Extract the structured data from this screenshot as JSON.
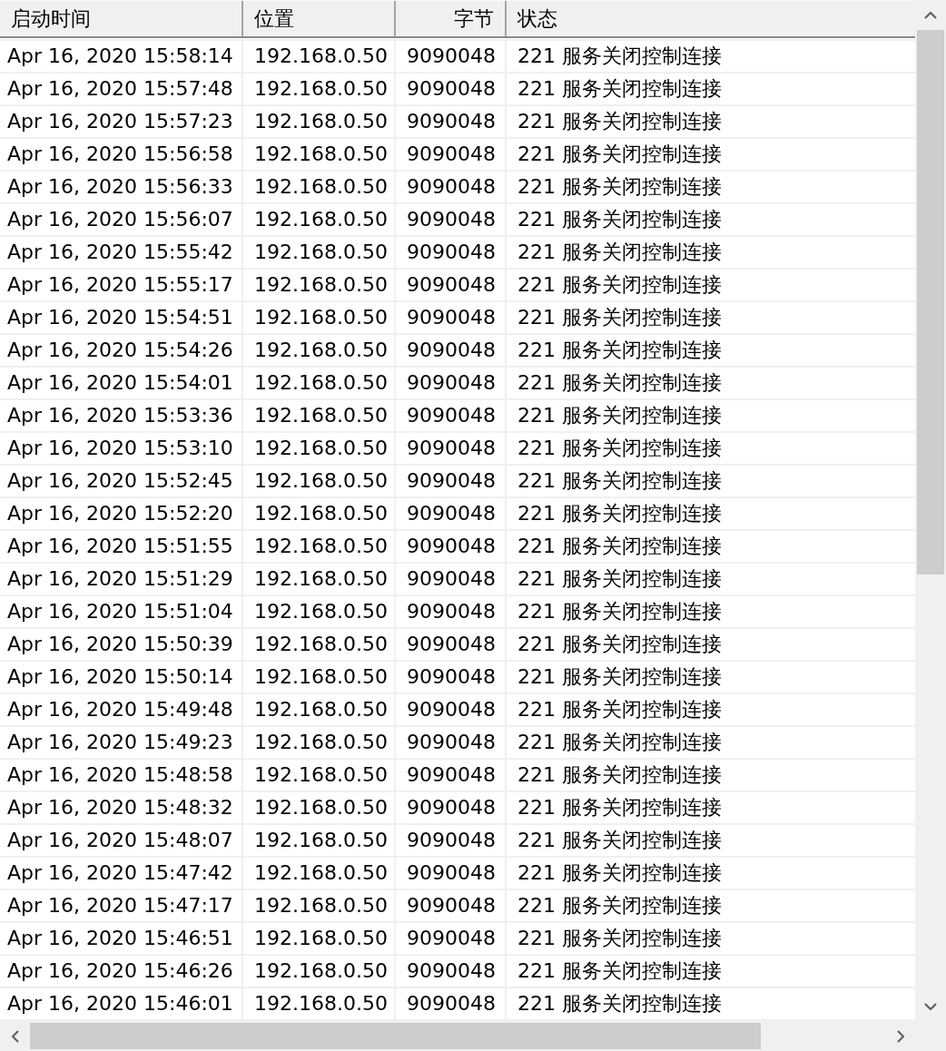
{
  "table": {
    "columns": [
      "启动时间",
      "位置",
      "字节",
      "状态"
    ],
    "rows": [
      [
        "Apr 16, 2020 15:58:14",
        "192.168.0.50",
        "9090048",
        "221 服务关闭控制连接"
      ],
      [
        "Apr 16, 2020 15:57:48",
        "192.168.0.50",
        "9090048",
        "221 服务关闭控制连接"
      ],
      [
        "Apr 16, 2020 15:57:23",
        "192.168.0.50",
        "9090048",
        "221 服务关闭控制连接"
      ],
      [
        "Apr 16, 2020 15:56:58",
        "192.168.0.50",
        "9090048",
        "221 服务关闭控制连接"
      ],
      [
        "Apr 16, 2020 15:56:33",
        "192.168.0.50",
        "9090048",
        "221 服务关闭控制连接"
      ],
      [
        "Apr 16, 2020 15:56:07",
        "192.168.0.50",
        "9090048",
        "221 服务关闭控制连接"
      ],
      [
        "Apr 16, 2020 15:55:42",
        "192.168.0.50",
        "9090048",
        "221 服务关闭控制连接"
      ],
      [
        "Apr 16, 2020 15:55:17",
        "192.168.0.50",
        "9090048",
        "221 服务关闭控制连接"
      ],
      [
        "Apr 16, 2020 15:54:51",
        "192.168.0.50",
        "9090048",
        "221 服务关闭控制连接"
      ],
      [
        "Apr 16, 2020 15:54:26",
        "192.168.0.50",
        "9090048",
        "221 服务关闭控制连接"
      ],
      [
        "Apr 16, 2020 15:54:01",
        "192.168.0.50",
        "9090048",
        "221 服务关闭控制连接"
      ],
      [
        "Apr 16, 2020 15:53:36",
        "192.168.0.50",
        "9090048",
        "221 服务关闭控制连接"
      ],
      [
        "Apr 16, 2020 15:53:10",
        "192.168.0.50",
        "9090048",
        "221 服务关闭控制连接"
      ],
      [
        "Apr 16, 2020 15:52:45",
        "192.168.0.50",
        "9090048",
        "221 服务关闭控制连接"
      ],
      [
        "Apr 16, 2020 15:52:20",
        "192.168.0.50",
        "9090048",
        "221 服务关闭控制连接"
      ],
      [
        "Apr 16, 2020 15:51:55",
        "192.168.0.50",
        "9090048",
        "221 服务关闭控制连接"
      ],
      [
        "Apr 16, 2020 15:51:29",
        "192.168.0.50",
        "9090048",
        "221 服务关闭控制连接"
      ],
      [
        "Apr 16, 2020 15:51:04",
        "192.168.0.50",
        "9090048",
        "221 服务关闭控制连接"
      ],
      [
        "Apr 16, 2020 15:50:39",
        "192.168.0.50",
        "9090048",
        "221 服务关闭控制连接"
      ],
      [
        "Apr 16, 2020 15:50:14",
        "192.168.0.50",
        "9090048",
        "221 服务关闭控制连接"
      ],
      [
        "Apr 16, 2020 15:49:48",
        "192.168.0.50",
        "9090048",
        "221 服务关闭控制连接"
      ],
      [
        "Apr 16, 2020 15:49:23",
        "192.168.0.50",
        "9090048",
        "221 服务关闭控制连接"
      ],
      [
        "Apr 16, 2020 15:48:58",
        "192.168.0.50",
        "9090048",
        "221 服务关闭控制连接"
      ],
      [
        "Apr 16, 2020 15:48:32",
        "192.168.0.50",
        "9090048",
        "221 服务关闭控制连接"
      ],
      [
        "Apr 16, 2020 15:48:07",
        "192.168.0.50",
        "9090048",
        "221 服务关闭控制连接"
      ],
      [
        "Apr 16, 2020 15:47:42",
        "192.168.0.50",
        "9090048",
        "221 服务关闭控制连接"
      ],
      [
        "Apr 16, 2020 15:47:17",
        "192.168.0.50",
        "9090048",
        "221 服务关闭控制连接"
      ],
      [
        "Apr 16, 2020 15:46:51",
        "192.168.0.50",
        "9090048",
        "221 服务关闭控制连接"
      ],
      [
        "Apr 16, 2020 15:46:26",
        "192.168.0.50",
        "9090048",
        "221 服务关闭控制连接"
      ],
      [
        "Apr 16, 2020 15:46:01",
        "192.168.0.50",
        "9090048",
        "221 服务关闭控制连接"
      ]
    ]
  }
}
